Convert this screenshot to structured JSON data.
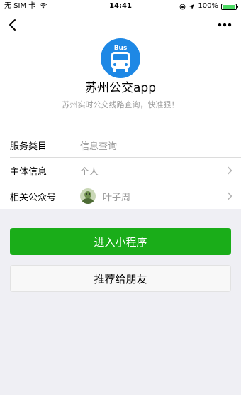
{
  "status_bar": {
    "carrier": "无 SIM 卡",
    "time": "14:41",
    "battery_percent": "100%",
    "battery_level": 1.0
  },
  "nav": {
    "back_icon": "chevron-left-icon",
    "more_icon": "more-dots-icon"
  },
  "app": {
    "name": "苏州公交app",
    "description": "苏州实时公交线路查询，快准狠！",
    "logo_text": "Bus",
    "logo_color": "#1e88e5"
  },
  "info": {
    "category_label": "服务类目",
    "category_value": "信息查询",
    "entity_label": "主体信息",
    "entity_value": "个人",
    "account_label": "相关公众号",
    "account_name": "叶子周"
  },
  "actions": {
    "enter_label": "进入小程序",
    "share_label": "推荐给朋友"
  },
  "colors": {
    "primary": "#1aad19",
    "muted_text": "#9b9b9b",
    "page_bg": "#efeff4"
  }
}
